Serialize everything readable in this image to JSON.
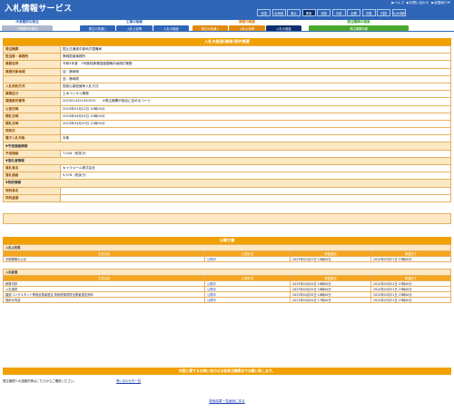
{
  "header": {
    "title": "入札情報サービス",
    "links": [
      "▶ヘルプ",
      "▶お問い合わせ",
      "▶全国版TOP"
    ],
    "regions": [
      "全国",
      "北海道",
      "東北",
      "関東",
      "北陸",
      "中部",
      "近畿",
      "中国",
      "四国",
      "九州沖縄"
    ],
    "selected_region": "関東"
  },
  "nav": {
    "groups": [
      {
        "title": "中長期的な発注",
        "title_color": "#2f66b8",
        "tabs": [
          "中長期的な発注"
        ],
        "tab_color": "#aeb8cc",
        "selected": -1
      },
      {
        "title": "工事の検索",
        "title_color": "#2f66b8",
        "tabs": [
          "発注の見通し",
          "入札公告等",
          "入札の経過"
        ],
        "tab_color": "#2f66b8",
        "selected": -1
      },
      {
        "title": "業務の検索",
        "title_color": "#e07b00",
        "tabs": [
          "発注の見通し",
          "入札公告等",
          "入札の経過"
        ],
        "tab_color": "#e08a10",
        "selected": 2
      },
      {
        "title": "発注機関の検索",
        "title_color": "#3aa02e",
        "tabs": [
          "発注機関情報"
        ],
        "tab_color": "#4aa82e",
        "selected": -1
      }
    ]
  },
  "detail": {
    "title": "入札の経過(業務)案件概要",
    "rows": [
      {
        "label": "発注機関",
        "value": "国土交通省中部地方整備局"
      },
      {
        "label": "担当部・事務所",
        "value": "静岡国道事務所"
      },
      {
        "label": "業務名称",
        "value": "令和5年度　1号藤枝静清国道整備計画検討業務"
      },
      {
        "label": "業務対象地域",
        "value": "自：静岡県"
      },
      {
        "label": "",
        "value": "至：静岡県"
      },
      {
        "label": "入札契約方式",
        "value": "簡易公募型競争入札方式"
      },
      {
        "label": "業務区分",
        "value": "土木コンサル業務"
      },
      {
        "label": "調達案件番号",
        "value": "2023014321020012　　※発注機関が独自に定めるコード"
      },
      {
        "label": "公告日時",
        "value": "2023年01月22日 10時00分"
      },
      {
        "label": "開札日時",
        "value": "2023年04月05日 10時00分"
      },
      {
        "label": "開札日時",
        "value": "2023年04月20日 11時00分"
      },
      {
        "label": "契約日",
        "value": ""
      },
      {
        "label": "電子入札対象",
        "value": "対象"
      }
    ],
    "price_section": "▼予定価格情報",
    "price_label": "予定価格",
    "price_value": "7,044（税抜き）",
    "winner_section": "▼落札者情報",
    "winner_rows": [
      {
        "label": "落札者名",
        "value": "キャラメール株式会社"
      },
      {
        "label": "落札価格",
        "value": "5,576（税抜き）"
      }
    ],
    "contract_section": "▼契約情報",
    "contract_rows": [
      {
        "label": "契約者名",
        "value": ""
      },
      {
        "label": "契約金額",
        "value": ""
      }
    ]
  },
  "docs": {
    "title": "公開文書",
    "notice": {
      "heading": "入札公告等",
      "columns": [
        "文書名称",
        "公開状況",
        "掲載開始",
        "掲載終了"
      ],
      "rows": [
        {
          "name": "中期業務の公示",
          "status": "公開中",
          "start": "2023年01月22日 10時00分",
          "end": "2024年03月31日 23時00分"
        }
      ]
    },
    "history": {
      "heading": "入札経過",
      "columns": [
        "文書名称",
        "公開状況",
        "掲載開始",
        "掲載終了"
      ],
      "rows": [
        {
          "name": "積算内訳",
          "status": "公開中",
          "start": "2023年04月20日 16時00分",
          "end": "2024年03月31日 23時00分"
        },
        {
          "name": "入札調書",
          "status": "公開中",
          "start": "2023年04月20日 16時00分",
          "end": "2024年03月31日 23時00分"
        },
        {
          "name": "建設コンサルタント等指名業者選定 技術提案書提出業者選定資料",
          "status": "公開中",
          "start": "2023年04月20日 16時00分",
          "end": "2024年03月31日 23時00分"
        },
        {
          "name": "契約の内容",
          "status": "公開中",
          "start": "2023年04月20日 17時00分",
          "end": "2024年03月31日 23時00分"
        }
      ]
    }
  },
  "footer": {
    "notice": "内容に関するお問い合わせは各発注機関までお願い致します。",
    "contact_text": "発注機関への連絡先等はこちらからご確認ください。",
    "contact_link": "問い合わせ先一覧",
    "back_link": "検索結果一覧画面に戻る"
  }
}
